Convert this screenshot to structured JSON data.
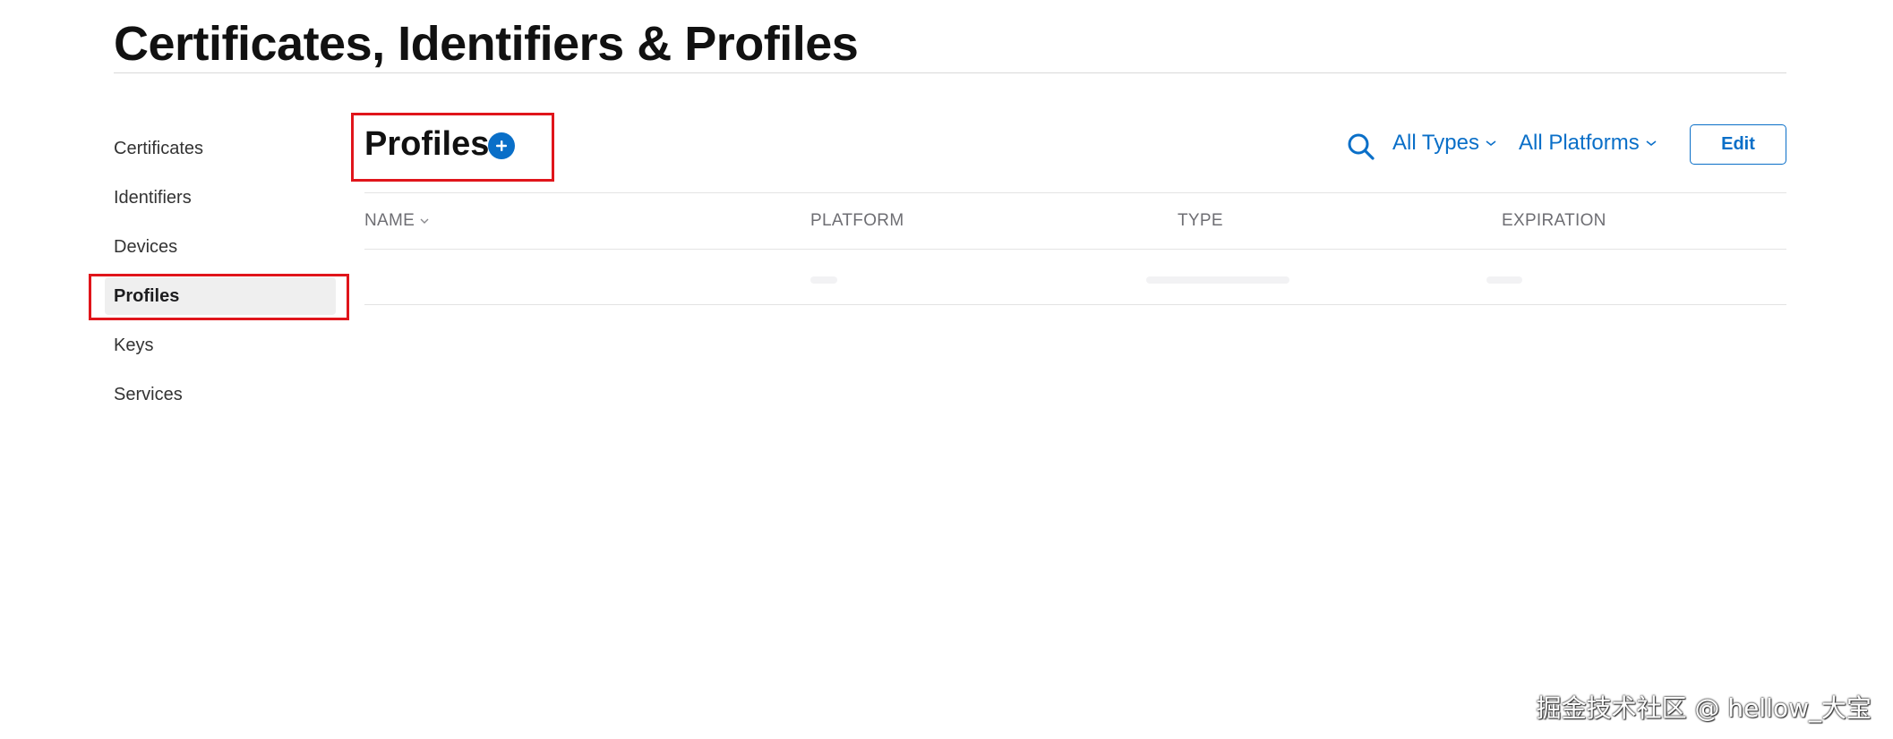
{
  "page": {
    "title": "Certificates, Identifiers & Profiles"
  },
  "sidebar": {
    "items": [
      {
        "label": "Certificates",
        "active": false
      },
      {
        "label": "Identifiers",
        "active": false
      },
      {
        "label": "Devices",
        "active": false
      },
      {
        "label": "Profiles",
        "active": true
      },
      {
        "label": "Keys",
        "active": false
      },
      {
        "label": "Services",
        "active": false
      }
    ]
  },
  "section": {
    "title": "Profiles",
    "add_icon": "plus-circle-icon"
  },
  "toolbar": {
    "search_icon": "search-icon",
    "type_filter_label": "All Types",
    "platform_filter_label": "All Platforms",
    "edit_label": "Edit"
  },
  "table": {
    "columns": [
      "NAME",
      "PLATFORM",
      "TYPE",
      "EXPIRATION"
    ],
    "sorted_column": "NAME",
    "rows": []
  },
  "watermark": {
    "text": "掘金技术社区 @ hellow_大宝"
  },
  "colors": {
    "accent": "#0a6fc8",
    "annotation_red": "#e0151b",
    "active_bg": "#efefef"
  }
}
